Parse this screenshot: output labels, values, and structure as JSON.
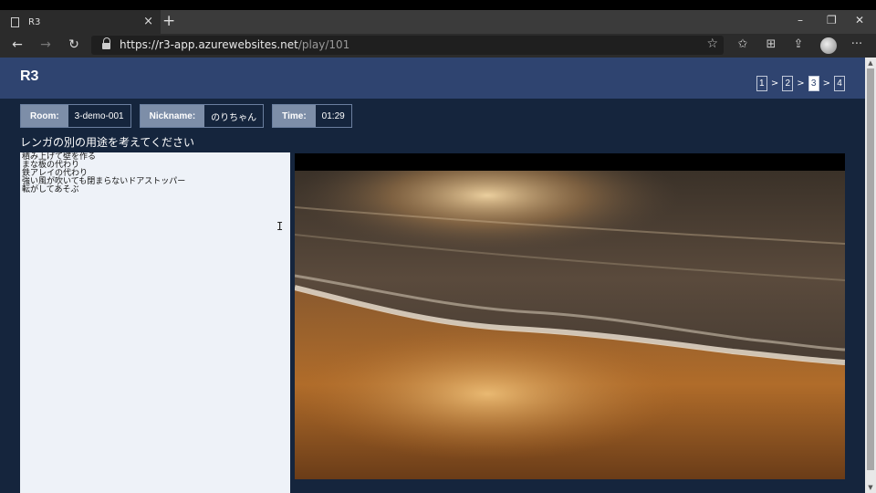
{
  "browser": {
    "tab_title": "R3",
    "new_tab": "+",
    "tab_close": "×",
    "url_host": "https://r3-app.azurewebsites.net",
    "url_path": "/play/101",
    "window_controls": {
      "minimize": "–",
      "restore": "❐",
      "close": "✕"
    },
    "nav": {
      "back": "←",
      "forward": "→",
      "refresh": "↻"
    },
    "toolbar_icons": {
      "favorite": "☆",
      "favorites": "✩",
      "collections": "⊞",
      "share": "⇪",
      "more": "···"
    }
  },
  "app": {
    "title": "R3",
    "pager": {
      "pages": [
        "1",
        "2",
        "3",
        "4"
      ],
      "separator": ">",
      "current": "3"
    },
    "room": {
      "label": "Room:",
      "value": "3-demo-001"
    },
    "nickname": {
      "label": "Nickname:",
      "value": "のりちゃん"
    },
    "time": {
      "label": "Time:",
      "value": "01:29"
    },
    "question": "レンガの別の用途を考えてください",
    "answer_lines": "積み上げて壁を作る\nまな板の代わり\n鉄アレイの代わり\n強い風が吹いても閉まらないドアストッパー\n転がしてあそぶ",
    "cursor_glyph": "I"
  },
  "colors": {
    "header": "#2f4470",
    "background": "#15253d",
    "label_bg": "#7d8ea8"
  }
}
